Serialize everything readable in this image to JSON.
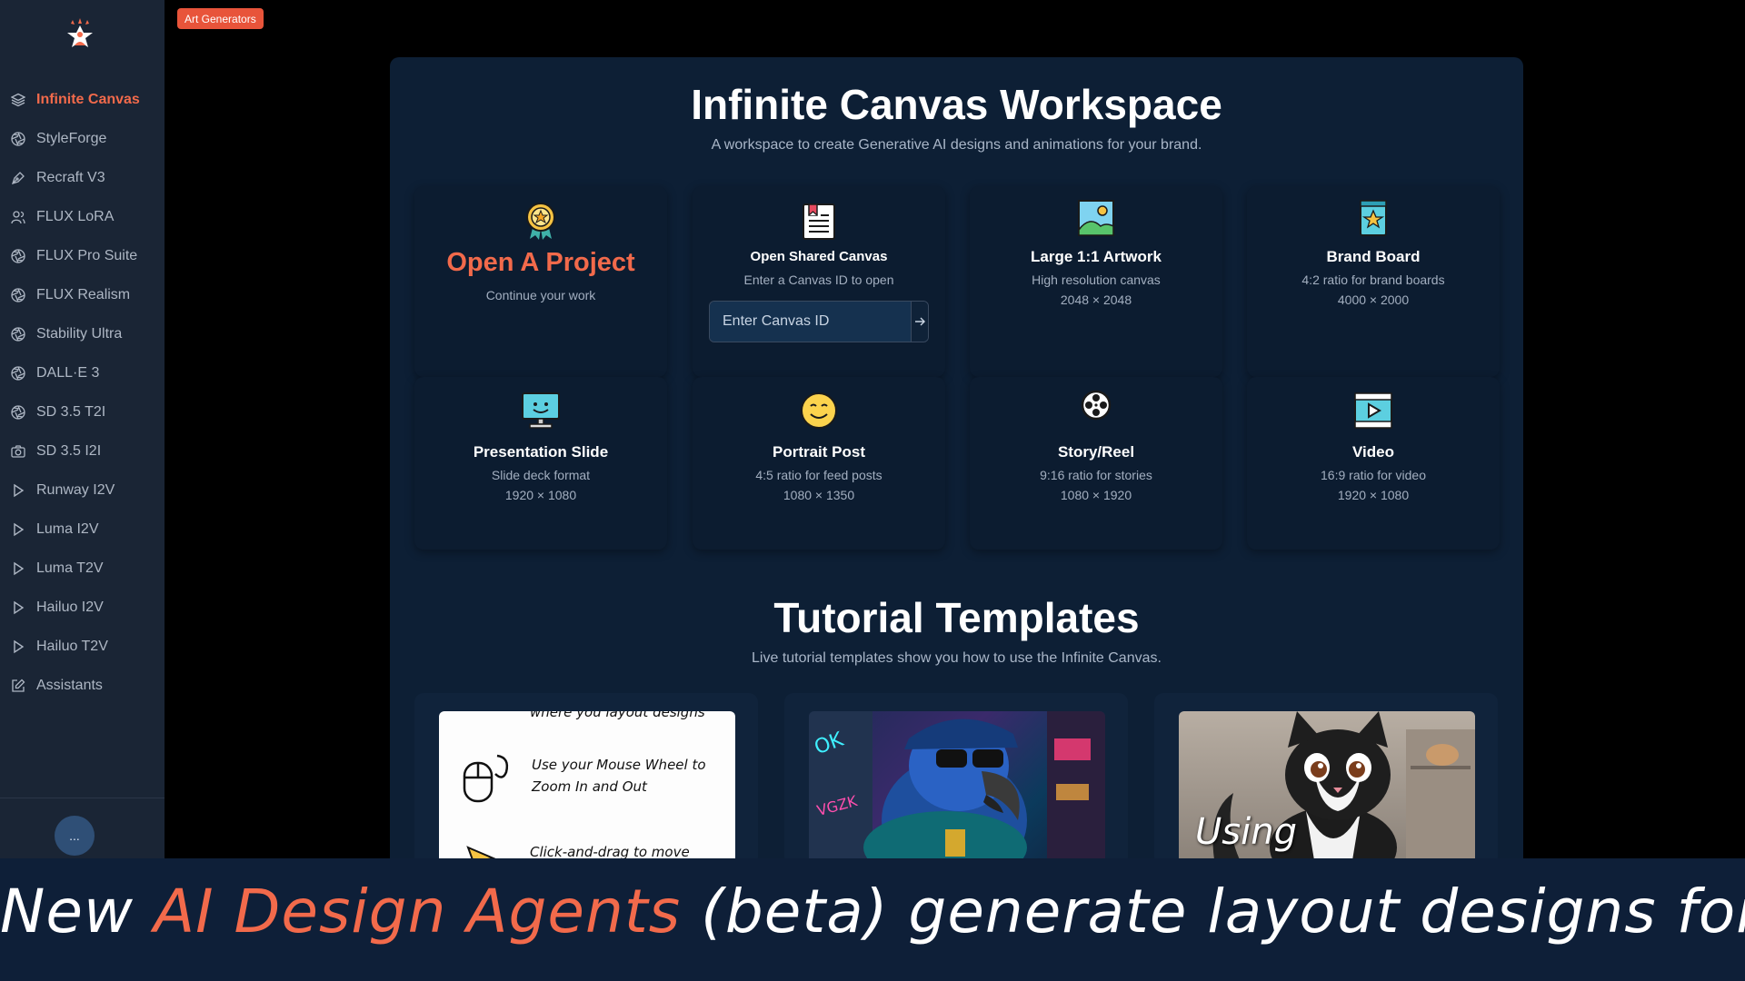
{
  "badge": "Art Generators",
  "sidebar": {
    "items": [
      {
        "label": "Infinite Canvas",
        "icon": "layers-icon",
        "active": true
      },
      {
        "label": "StyleForge",
        "icon": "aperture-icon"
      },
      {
        "label": "Recraft V3",
        "icon": "pen-tool-icon"
      },
      {
        "label": "FLUX LoRA",
        "icon": "users-icon"
      },
      {
        "label": "FLUX Pro Suite",
        "icon": "aperture-icon"
      },
      {
        "label": "FLUX Realism",
        "icon": "aperture-icon"
      },
      {
        "label": "Stability Ultra",
        "icon": "aperture-icon"
      },
      {
        "label": "DALL·E 3",
        "icon": "aperture-icon"
      },
      {
        "label": "SD 3.5 T2I",
        "icon": "aperture-icon"
      },
      {
        "label": "SD 3.5 I2I",
        "icon": "camera-icon"
      },
      {
        "label": "Runway I2V",
        "icon": "play-icon"
      },
      {
        "label": "Luma I2V",
        "icon": "play-icon"
      },
      {
        "label": "Luma T2V",
        "icon": "play-icon"
      },
      {
        "label": "Hailuo I2V",
        "icon": "play-icon"
      },
      {
        "label": "Hailuo T2V",
        "icon": "play-icon"
      },
      {
        "label": "Assistants",
        "icon": "edit-icon"
      }
    ],
    "more_label": "..."
  },
  "workspace": {
    "title": "Infinite Canvas Workspace",
    "subtitle": "A workspace to create Generative AI designs and animations for your brand.",
    "open_project": {
      "title": "Open A Project",
      "desc": "Continue your work",
      "icon": "award-icon"
    },
    "shared_canvas": {
      "title": "Open Shared Canvas",
      "desc": "Enter a Canvas ID to open",
      "placeholder": "Enter Canvas ID",
      "icon": "document-icon"
    },
    "cards": [
      {
        "title": "Large 1:1 Artwork",
        "desc": "High resolution canvas",
        "size": "2048 × 2048",
        "icon": "landscape-icon"
      },
      {
        "title": "Brand Board",
        "desc": "4:2 ratio for brand boards",
        "size": "4000 × 2000",
        "icon": "star-book-icon"
      },
      {
        "title": "Presentation Slide",
        "desc": "Slide deck format",
        "size": "1920 × 1080",
        "icon": "monitor-icon"
      },
      {
        "title": "Portrait Post",
        "desc": "4:5 ratio for feed posts",
        "size": "1080 × 1350",
        "icon": "smiley-icon"
      },
      {
        "title": "Story/Reel",
        "desc": "9:16 ratio for stories",
        "size": "1080 × 1920",
        "icon": "film-reel-icon"
      },
      {
        "title": "Video",
        "desc": "16:9 ratio for video",
        "size": "1920 × 1080",
        "icon": "video-icon"
      }
    ]
  },
  "tutorials": {
    "title": "Tutorial Templates",
    "subtitle": "Live tutorial templates show you how to use the Infinite Canvas.",
    "card1": {
      "line0": "where you layout designs",
      "line1": "Use your Mouse Wheel to",
      "line2": "Zoom In and Out",
      "line3": "Click-and-drag to move"
    },
    "card3": {
      "overlay": "Using"
    }
  },
  "banner": {
    "pre": "New ",
    "highlight": "AI Design Agents",
    "post": " (beta) generate layout designs for you!"
  }
}
